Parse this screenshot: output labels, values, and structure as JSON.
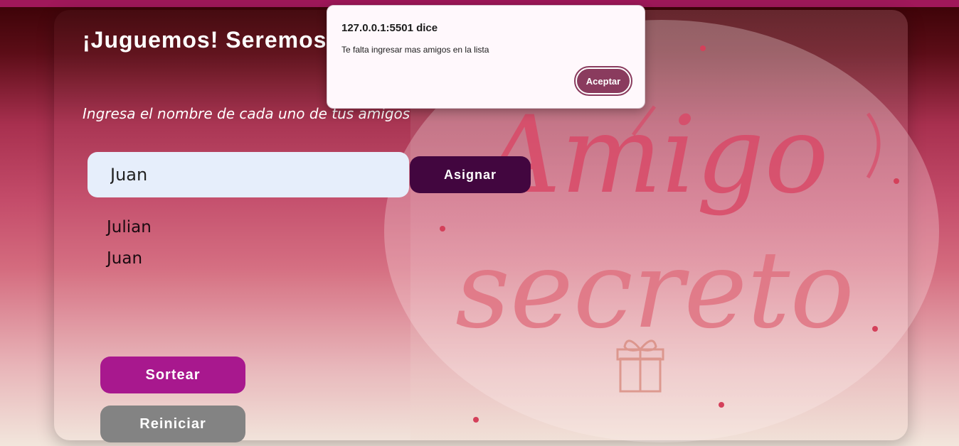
{
  "app": {
    "title": "¡Juguemos! Seremos personas",
    "instruction": "Ingresa el nombre de cada uno de tus amigos"
  },
  "form": {
    "name_value": "Juan",
    "assign_label": "Asignar"
  },
  "friends": [
    "Julian",
    "Juan"
  ],
  "actions": {
    "draw_label": "Sortear",
    "reset_label": "Reiniciar"
  },
  "dialog": {
    "title": "127.0.0.1:5501 dice",
    "message": "Te falta ingresar mas amigos en la lista",
    "ok_label": "Aceptar"
  },
  "illustration": {
    "word_1": "Amigo",
    "word_2": "secreto"
  },
  "colors": {
    "accent_dark": "#42063f",
    "accent_magenta": "#a8188e",
    "neutral_gray": "#838383",
    "dialog_button": "#8a3b5e"
  }
}
